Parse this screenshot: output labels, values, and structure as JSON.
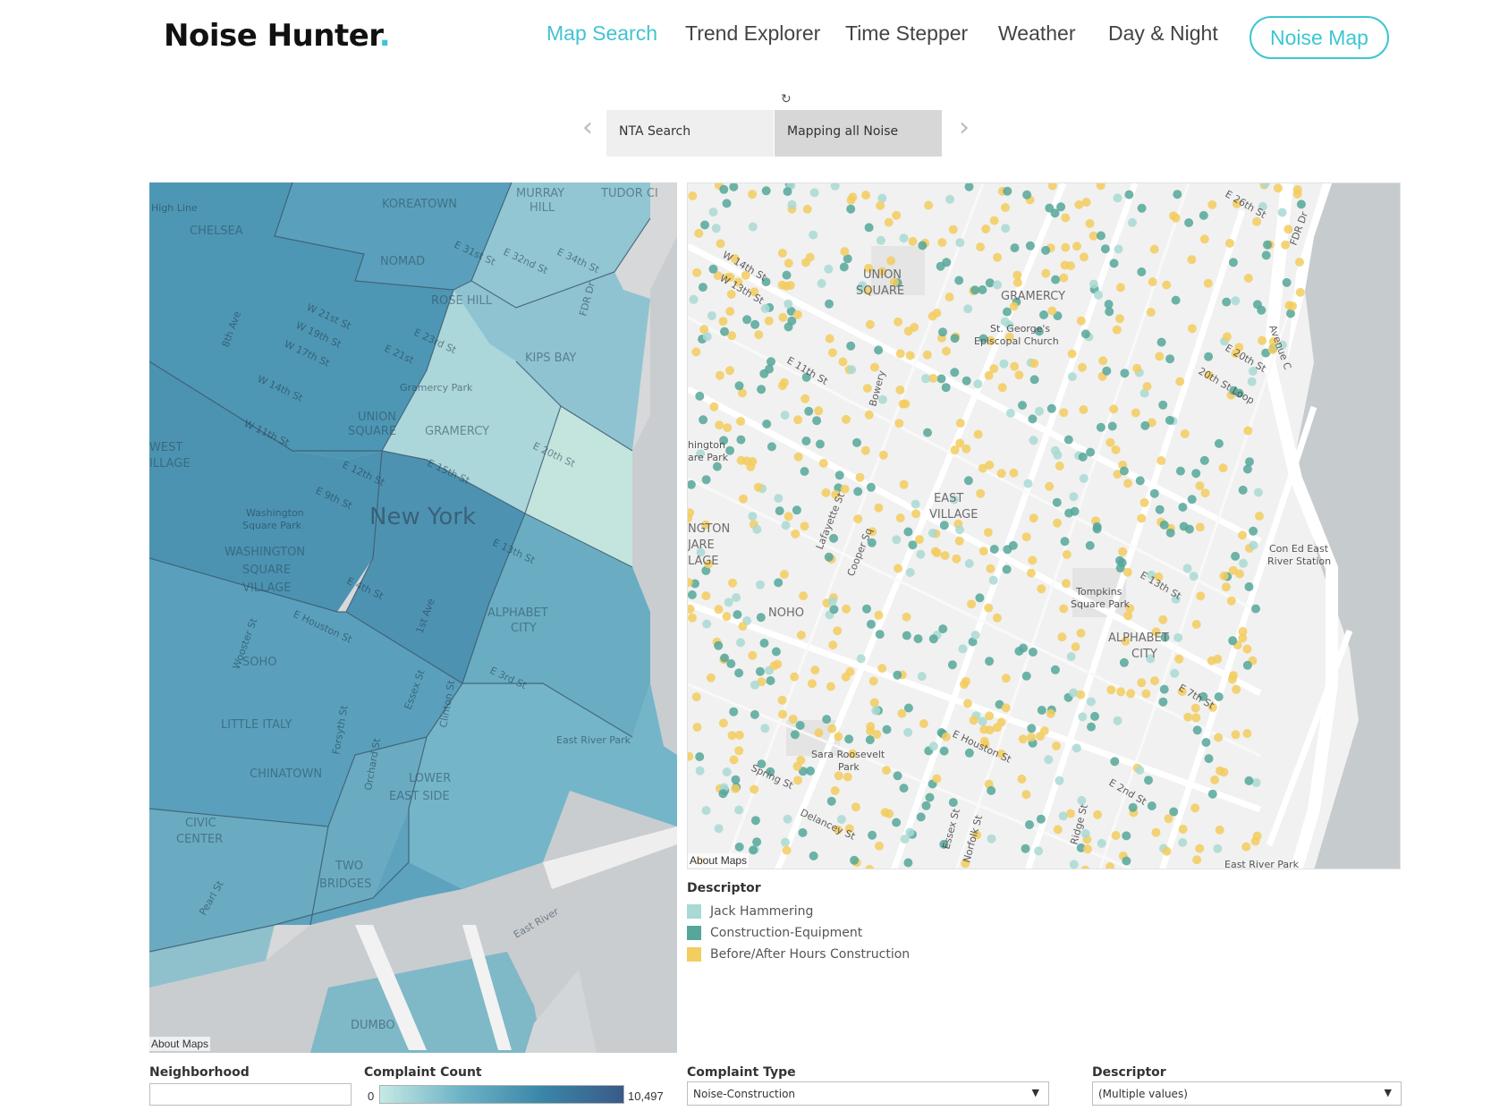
{
  "brand": {
    "name": "Noise Hunter",
    "dot": "."
  },
  "nav": {
    "items": [
      {
        "label": "Map Search",
        "active": true
      },
      {
        "label": "Trend Explorer",
        "active": false
      },
      {
        "label": "Time Stepper",
        "active": false
      },
      {
        "label": "Weather",
        "active": false
      },
      {
        "label": "Day & Night",
        "active": false
      }
    ],
    "cta": "Noise Map"
  },
  "story": {
    "refresh_icon": "refresh-icon",
    "prev_icon": "chevron-left-icon",
    "next_icon": "chevron-right-icon",
    "tabs": [
      {
        "label": "NTA Search"
      },
      {
        "label": "Mapping all Noise"
      }
    ]
  },
  "map_left": {
    "center_label": "New York",
    "neighborhoods": [
      "KOREATOWN",
      "MURRAY HILL",
      "TUDOR CITY",
      "CHELSEA",
      "NOMAD",
      "ROSE HILL",
      "KIPS BAY",
      "UNION SQUARE",
      "GRAMERCY",
      "WEST VILLAGE",
      "WASHINGTON SQUARE VILLAGE",
      "ALPHABET CITY",
      "SOHO",
      "LITTLE ITALY",
      "CHINATOWN",
      "LOWER EAST SIDE",
      "CIVIC CENTER",
      "TWO BRIDGES",
      "DUMBO"
    ],
    "streets": [
      "High Line",
      "W 21st St",
      "W 19th St",
      "W 17th St",
      "W 14th St",
      "W 11th St",
      "E 31st St",
      "E 32nd St",
      "E 34th St",
      "E 23rd St",
      "E 21st St",
      "E 20th St",
      "E 15th St",
      "E 12th St",
      "E 9th St",
      "E 13th St",
      "E 4th St",
      "E Houston St",
      "E 3rd St",
      "1st Ave",
      "8th Ave",
      "FDR Dr",
      "Essex St",
      "Orchard St",
      "Forsyth St",
      "Clinton St",
      "Wooster St",
      "Pearl St",
      "East River Park",
      "East River",
      "Gramercy Park",
      "Washington Square Park"
    ],
    "about": "About Maps"
  },
  "map_right": {
    "labels": [
      "UNION SQUARE",
      "GRAMERCY",
      "St. George's Episcopal Church",
      "EAST VILLAGE",
      "NOHO",
      "ALPHABET CITY",
      "Tompkins Square Park",
      "Sara Roosevelt Park",
      "Con Ed East River Station",
      "Washington Square Park",
      "FDR Dr",
      "E 26th St",
      "E 20th St",
      "20th St Loop",
      "Avenue C",
      "E 7th St",
      "E 2nd St",
      "E Houston St",
      "Delancey St",
      "Spring St",
      "Lafayette St",
      "Cooper Sq",
      "Bowery",
      "Essex St",
      "Norfolk St",
      "Ridge St",
      "W 14th St",
      "W 13th St",
      "E 11th St",
      "E 13th St",
      "East River Park"
    ],
    "about": "About Maps"
  },
  "legend": {
    "title": "Descriptor",
    "items": [
      {
        "label": "Jack Hammering",
        "color": "#a9d9d4"
      },
      {
        "label": "Construction-Equipment",
        "color": "#55a79a"
      },
      {
        "label": "Before/After Hours Construction",
        "color": "#f3cd5f"
      }
    ]
  },
  "filters": {
    "neighborhood": {
      "label": "Neighborhood",
      "value": ""
    },
    "complaint_count": {
      "label": "Complaint Count",
      "min": "0",
      "max": "10,497"
    },
    "complaint_type": {
      "label": "Complaint Type",
      "value": "Noise-Construction"
    },
    "descriptor": {
      "label": "Descriptor",
      "value": "(Multiple values)"
    }
  }
}
